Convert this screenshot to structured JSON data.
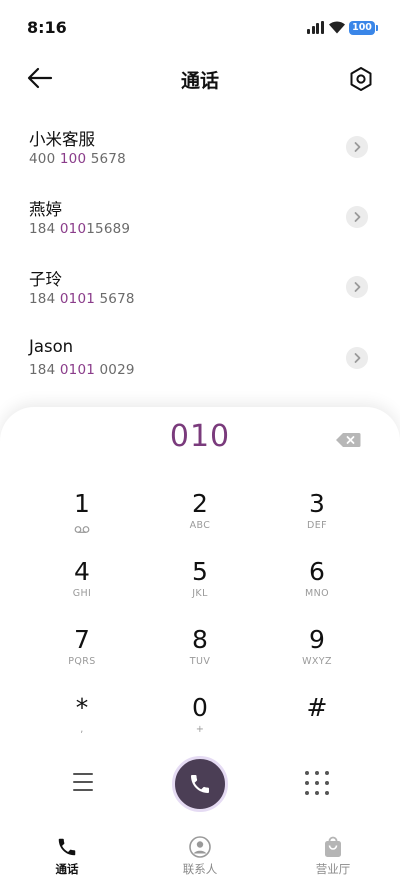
{
  "status": {
    "time": "8:16",
    "battery": "100"
  },
  "header": {
    "title": "通话",
    "back_icon": "arrow-left-icon",
    "settings_icon": "hexagon-settings-icon"
  },
  "contacts": [
    {
      "name": "小米客服",
      "number_parts": [
        "400 ",
        "100",
        " 5678"
      ]
    },
    {
      "name": "燕婷",
      "number_parts": [
        "184 ",
        "010",
        "15689"
      ]
    },
    {
      "name": "子玲",
      "number_parts": [
        "184 ",
        "0101",
        " 5678"
      ]
    },
    {
      "name": "Jason",
      "number_parts": [
        "184 ",
        "0101",
        " 0029"
      ]
    }
  ],
  "dialer": {
    "input": "010",
    "keys": [
      {
        "digit": "1",
        "letters": ""
      },
      {
        "digit": "2",
        "letters": "ABC"
      },
      {
        "digit": "3",
        "letters": "DEF"
      },
      {
        "digit": "4",
        "letters": "GHI"
      },
      {
        "digit": "5",
        "letters": "JKL"
      },
      {
        "digit": "6",
        "letters": "MNO"
      },
      {
        "digit": "7",
        "letters": "PQRS"
      },
      {
        "digit": "8",
        "letters": "TUV"
      },
      {
        "digit": "9",
        "letters": "WXYZ"
      },
      {
        "digit": "*",
        "letters": ","
      },
      {
        "digit": "0",
        "letters": "+"
      },
      {
        "digit": "#",
        "letters": ""
      }
    ]
  },
  "tabs": [
    {
      "label": "通话",
      "icon": "phone-icon",
      "active": true
    },
    {
      "label": "联系人",
      "icon": "contact-person-icon",
      "active": false
    },
    {
      "label": "营业厅",
      "icon": "shopping-bag-icon",
      "active": false
    }
  ],
  "colors": {
    "highlight": "#8a3c8a",
    "call_button": "#4b3e55",
    "battery": "#3a86e8"
  }
}
